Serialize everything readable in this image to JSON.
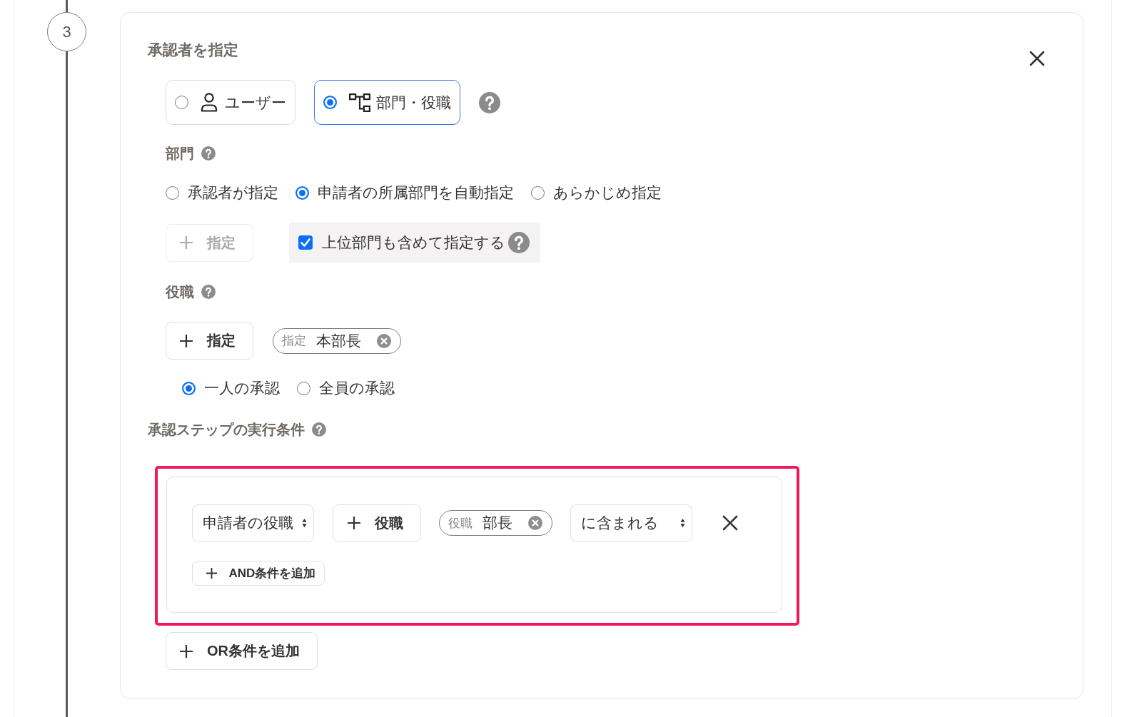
{
  "step": {
    "number": "3"
  },
  "approver_panel": {
    "title": "承認者を指定",
    "type_options": [
      {
        "kind": "user",
        "label": "ユーザー",
        "selected": false
      },
      {
        "kind": "department_position",
        "label": "部門・役職",
        "selected": true
      }
    ],
    "department": {
      "label": "部門",
      "modes": [
        {
          "label": "承認者が指定",
          "selected": false
        },
        {
          "label": "申請者の所属部門を自動指定",
          "selected": true
        },
        {
          "label": "あらかじめ指定",
          "selected": false
        }
      ],
      "add_button": {
        "label": "指定",
        "disabled": true
      },
      "include_parent": {
        "label": "上位部門も含めて指定する",
        "checked": true
      }
    },
    "position": {
      "label": "役職",
      "add_button": {
        "label": "指定",
        "disabled": false
      },
      "tags": [
        {
          "prefix": "指定",
          "value": "本部長"
        }
      ],
      "approval_modes": [
        {
          "label": "一人の承認",
          "selected": true
        },
        {
          "label": "全員の承認",
          "selected": false
        }
      ]
    },
    "conditions": {
      "label": "承認ステップの実行条件",
      "or_groups": [
        {
          "highlighted": true,
          "rules": [
            {
              "field": "申請者の役職",
              "add_button": "役職",
              "tags": [
                {
                  "prefix": "役職",
                  "value": "部長"
                }
              ],
              "operator": "に含まれる"
            }
          ],
          "and_button": "AND条件を追加"
        }
      ],
      "or_button": "OR条件を追加"
    }
  }
}
